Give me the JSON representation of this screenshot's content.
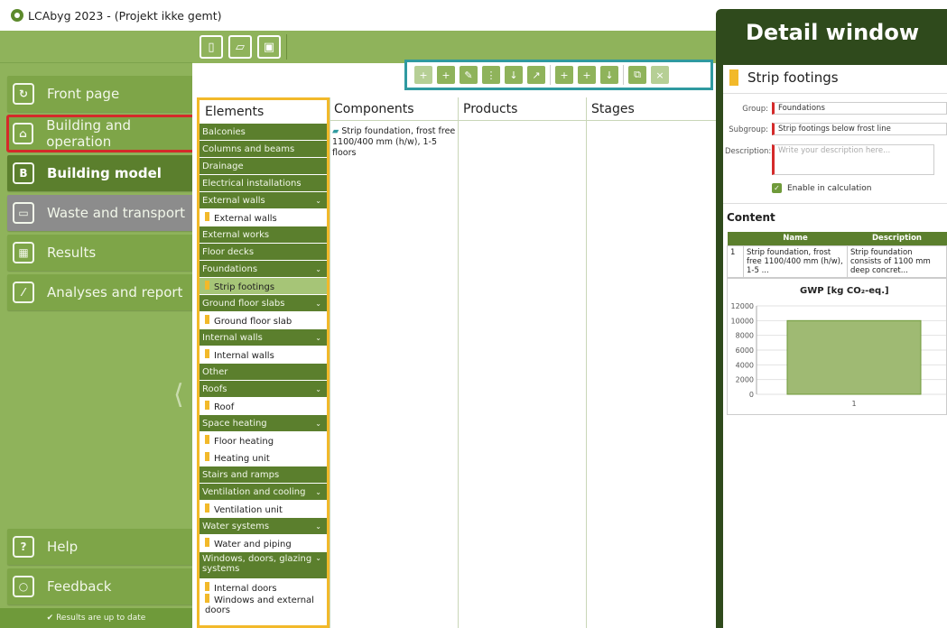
{
  "window": {
    "title": "LCAbyg 2023 - (Projekt ikke gemt)"
  },
  "sidebar": {
    "items": [
      {
        "label": "Front page",
        "icon": "refresh-icon"
      },
      {
        "label": "Building and operation",
        "icon": "house-icon"
      },
      {
        "label": "Building model",
        "icon": "building-model-icon"
      },
      {
        "label": "Waste and transport",
        "icon": "truck-icon"
      },
      {
        "label": "Results",
        "icon": "table-icon"
      },
      {
        "label": "Analyses and report",
        "icon": "chart-icon"
      }
    ],
    "help": "Help",
    "feedback": "Feedback",
    "status": "✔ Results are up to date"
  },
  "toolbar": {
    "new": "new-file-icon",
    "open": "open-folder-icon",
    "save": "save-icon"
  },
  "columns": {
    "elements": "Elements",
    "components": "Components",
    "products": "Products",
    "stages": "Stages"
  },
  "elements": [
    {
      "label": "Balconies",
      "type": "cat"
    },
    {
      "label": "Columns and beams",
      "type": "cat"
    },
    {
      "label": "Drainage",
      "type": "cat"
    },
    {
      "label": "Electrical installations",
      "type": "cat"
    },
    {
      "label": "External walls",
      "type": "cat",
      "chev": true
    },
    {
      "label": "External walls",
      "type": "item"
    },
    {
      "label": "External works",
      "type": "cat"
    },
    {
      "label": "Floor decks",
      "type": "cat"
    },
    {
      "label": "Foundations",
      "type": "cat",
      "chev": true
    },
    {
      "label": "Strip footings",
      "type": "item",
      "selected": true
    },
    {
      "label": "Ground floor slabs",
      "type": "cat",
      "chev": true
    },
    {
      "label": "Ground floor slab",
      "type": "item"
    },
    {
      "label": "Internal walls",
      "type": "cat",
      "chev": true
    },
    {
      "label": "Internal walls",
      "type": "item"
    },
    {
      "label": "Other",
      "type": "cat"
    },
    {
      "label": "Roofs",
      "type": "cat",
      "chev": true
    },
    {
      "label": "Roof",
      "type": "item"
    },
    {
      "label": "Space heating",
      "type": "cat",
      "chev": true
    },
    {
      "label": "Floor heating",
      "type": "item"
    },
    {
      "label": "Heating unit",
      "type": "item"
    },
    {
      "label": "Stairs and ramps",
      "type": "cat"
    },
    {
      "label": "Ventilation and cooling",
      "type": "cat",
      "chev": true
    },
    {
      "label": "Ventilation unit",
      "type": "item"
    },
    {
      "label": "Water systems",
      "type": "cat",
      "chev": true
    },
    {
      "label": "Water and piping",
      "type": "item"
    },
    {
      "label": "Windows, doors, glazing systems",
      "type": "cat",
      "chev": true,
      "tall": true
    },
    {
      "label": "Internal doors",
      "type": "item"
    },
    {
      "label": "Windows and external doors",
      "type": "item"
    }
  ],
  "components": {
    "item": "Strip foundation, frost free 1100/400 mm (h/w), 1-5 floors"
  },
  "detail": {
    "header": "Detail window",
    "title": "Strip footings",
    "group_label": "Group:",
    "group_value": "Foundations",
    "subgroup_label": "Subgroup:",
    "subgroup_value": "Strip footings below frost line",
    "description_label": "Description:",
    "description_placeholder": "Write your description here...",
    "enable_label": "Enable in calculation",
    "content_title": "Content",
    "table_headers": [
      "",
      "Name",
      "Description"
    ],
    "table_row": [
      "1",
      "Strip foundation, frost free 1100/400 mm (h/w), 1-5 ...",
      "Strip foundation consists of 1100 mm deep concret..."
    ]
  },
  "chart_data": {
    "type": "bar",
    "title": "GWP [kg CO₂-eq.]",
    "categories": [
      "1"
    ],
    "values": [
      10000
    ],
    "yticks": [
      0,
      2000,
      4000,
      6000,
      8000,
      10000,
      12000
    ],
    "ylim": [
      0,
      12000
    ],
    "grid": true,
    "bar_color": "#9fba73"
  },
  "colors": {
    "accent": "#5b7f2d",
    "sidebar": "#8fb35b",
    "highlight_elements": "#f2b92a",
    "highlight_actions": "#2f9aa0",
    "highlight_nav": "#d42a2a",
    "detail_bg": "#2f4a1c"
  }
}
